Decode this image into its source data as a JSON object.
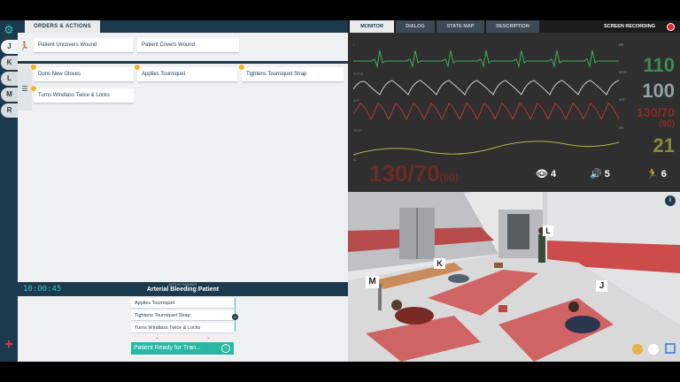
{
  "sidebar": {
    "tabs": [
      "J",
      "K",
      "L",
      "M",
      "R"
    ],
    "active_tab": "J"
  },
  "orders": {
    "tab_label": "ORDERS & ACTIONS",
    "row1": [
      "Patient Uncovers Wound",
      "Patient Covers Wound"
    ],
    "row2": [
      "Dons New Gloves",
      "Applies Tourniquet",
      "Tightens Tourniquet Strap",
      "Turns Windlass Twice & Locks"
    ]
  },
  "timer": "10:00:45",
  "active_patient": {
    "label": "ACTIVE PATIENT",
    "title": "Arterial Bleeding Patient"
  },
  "queue": {
    "items": [
      "Applies Tourniquet",
      "Tightens Tourniquet Strap",
      "Turns Windlass Twice & Locks"
    ],
    "badge": "4",
    "ready_button": "Patient Ready for Tran..."
  },
  "right_tabs": [
    "MONITOR",
    "DIALOG",
    "STATE MAP",
    "DESCRIPTION"
  ],
  "recording_label": "SCREEN RECORDING",
  "monitor": {
    "wave_labels": [
      "I",
      "PLETH",
      "ART",
      "RESP",
      "NI"
    ],
    "vital_labels": [
      "HR",
      "SPO2",
      "ART",
      "RR"
    ],
    "hr": "110",
    "spo2": "100",
    "art": "130/70",
    "art_sub": "(90)",
    "rr": "21",
    "nibp": "130/70",
    "nibp_sub": "(90)",
    "views": "4",
    "sounds": "5",
    "moves": "6"
  },
  "scene": {
    "signs": [
      "L",
      "K",
      "M",
      "J"
    ]
  },
  "colors": {
    "navy": "#1c3a4e",
    "teal": "#27b7a2",
    "ecg": "#3fae5a",
    "pleth": "#c9cfd1",
    "art": "#b43a30",
    "resp": "#b5b54a"
  }
}
